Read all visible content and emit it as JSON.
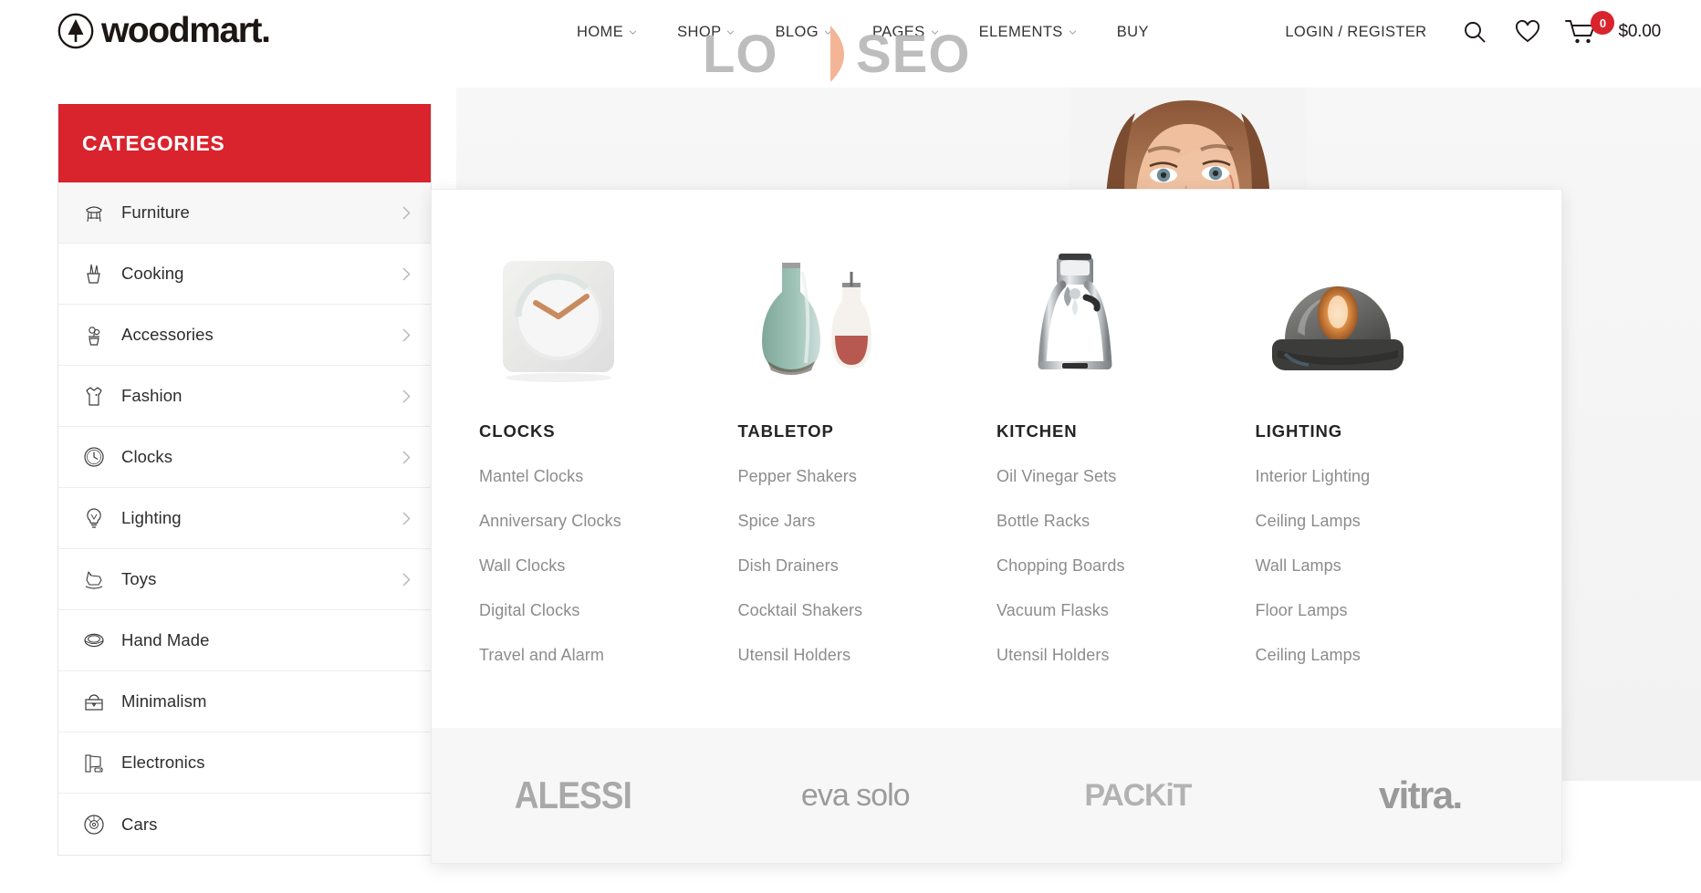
{
  "header": {
    "logo_text": "woodmart.",
    "logo_icon": "tree-circle-icon",
    "nav": [
      {
        "label": "HOME",
        "has_caret": true
      },
      {
        "label": "SHOP",
        "has_caret": true
      },
      {
        "label": "BLOG",
        "has_caret": true
      },
      {
        "label": "PAGES",
        "has_caret": true
      },
      {
        "label": "ELEMENTS",
        "has_caret": true
      },
      {
        "label": "BUY",
        "has_caret": false
      }
    ],
    "login_label": "LOGIN / REGISTER",
    "search_icon": "search-icon",
    "wishlist_icon": "heart-icon",
    "cart_icon": "shopping-cart-icon",
    "cart_count": "0",
    "cart_total": "$0.00"
  },
  "watermark": {
    "text_left": "LO",
    "text_right": "SEO",
    "logo_icon": "leaf-icon"
  },
  "sidebar": {
    "title": "CATEGORIES",
    "items": [
      {
        "label": "Furniture",
        "icon": "chair-icon",
        "has_arrow": true,
        "active": true
      },
      {
        "label": "Cooking",
        "icon": "knife-block-icon",
        "has_arrow": true,
        "active": false
      },
      {
        "label": "Accessories",
        "icon": "plant-pot-icon",
        "has_arrow": true,
        "active": false
      },
      {
        "label": "Fashion",
        "icon": "shirt-icon",
        "has_arrow": true,
        "active": false
      },
      {
        "label": "Clocks",
        "icon": "clock-icon",
        "has_arrow": true,
        "active": false
      },
      {
        "label": "Lighting",
        "icon": "lightbulb-icon",
        "has_arrow": true,
        "active": false
      },
      {
        "label": "Toys",
        "icon": "rocking-horse-icon",
        "has_arrow": true,
        "active": false
      },
      {
        "label": "Hand Made",
        "icon": "pottery-icon",
        "has_arrow": false,
        "active": false
      },
      {
        "label": "Minimalism",
        "icon": "briefcase-icon",
        "has_arrow": false,
        "active": false
      },
      {
        "label": "Electronics",
        "icon": "tv-console-icon",
        "has_arrow": false,
        "active": false
      },
      {
        "label": "Cars",
        "icon": "wheel-icon",
        "has_arrow": false,
        "active": false
      }
    ]
  },
  "megamenu": {
    "columns": [
      {
        "title": "CLOCKS",
        "thumb_icon": "square-wall-clock-image",
        "links": [
          "Mantel Clocks",
          "Anniversary Clocks",
          "Wall Clocks",
          "Digital Clocks",
          "Travel and Alarm"
        ]
      },
      {
        "title": "TABLETOP",
        "thumb_icon": "carafe-and-cruet-image",
        "links": [
          "Pepper Shakers",
          "Spice Jars",
          "Dish Drainers",
          "Cocktail Shakers",
          "Utensil Holders"
        ]
      },
      {
        "title": "KITCHEN",
        "thumb_icon": "espresso-maker-image",
        "links": [
          "Oil Vinegar Sets",
          "Bottle Racks",
          "Chopping Boards",
          "Vacuum Flasks",
          "Utensil Holders"
        ]
      },
      {
        "title": "LIGHTING",
        "thumb_icon": "dome-lamp-image",
        "links": [
          "Interior Lighting",
          "Ceiling Lamps",
          "Wall Lamps",
          "Floor Lamps",
          "Ceiling Lamps"
        ]
      }
    ],
    "brands": [
      {
        "name": "ALESSI",
        "style": "alessi"
      },
      {
        "name": "eva solo",
        "style": "eva"
      },
      {
        "name": "PACKiT",
        "style": "packit"
      },
      {
        "name": "vitra.",
        "style": "vitra"
      }
    ]
  },
  "colors": {
    "brand_red": "#d9232d",
    "text_dark": "#1c1614",
    "link_grey": "#8c8c8c"
  }
}
